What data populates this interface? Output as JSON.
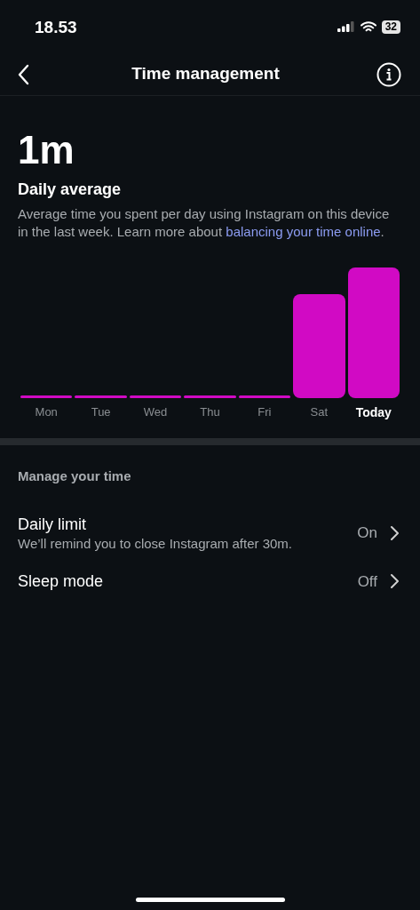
{
  "status_bar": {
    "time": "18.53",
    "battery": "32"
  },
  "nav": {
    "title": "Time management"
  },
  "summary": {
    "value": "1m",
    "label": "Daily average",
    "description": "Average time you spent per day using Instagram on this device in the last week. Learn more about ",
    "link": "balancing your time online",
    "suffix": "."
  },
  "days": [
    {
      "label": "Mon",
      "selected": false
    },
    {
      "label": "Tue",
      "selected": false
    },
    {
      "label": "Wed",
      "selected": false
    },
    {
      "label": "Thu",
      "selected": false
    },
    {
      "label": "Fri",
      "selected": false
    },
    {
      "label": "Sat",
      "selected": false
    },
    {
      "label": "Today",
      "selected": true
    }
  ],
  "section": {
    "title": "Manage your time"
  },
  "settings": [
    {
      "title": "Daily limit",
      "subtitle": "We’ll remind you to close Instagram after 30m.",
      "value": "On"
    },
    {
      "title": "Sleep mode",
      "value": "Off"
    }
  ]
}
